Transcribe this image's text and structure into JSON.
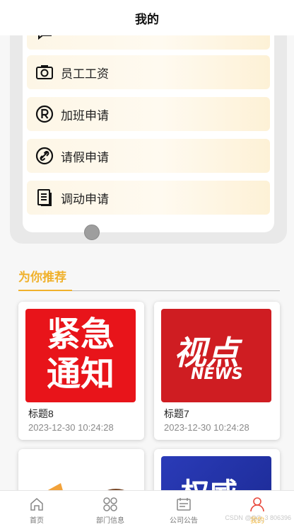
{
  "header": {
    "title": "我的"
  },
  "menu": {
    "items": [
      {
        "label": "",
        "icon": "chat-icon"
      },
      {
        "label": "员工工资",
        "icon": "camera-icon"
      },
      {
        "label": "加班申请",
        "icon": "registered-icon"
      },
      {
        "label": "请假申请",
        "icon": "link-icon"
      },
      {
        "label": "调动申请",
        "icon": "document-icon"
      }
    ]
  },
  "recommend": {
    "title": "为你推荐",
    "accent_color": "#f0b12c",
    "cards": [
      {
        "title": "标题8",
        "time": "2023-12-30 10:24:28",
        "image_text_line1": "紧急",
        "image_text_line2": "通知"
      },
      {
        "title": "标题7",
        "time": "2023-12-30 10:24:28",
        "image_text_line1": "视点",
        "image_text_line2": "NEWS"
      },
      {
        "title": "",
        "time": ""
      },
      {
        "title": "",
        "time": "",
        "image_text_line1": "权威"
      }
    ]
  },
  "tabbar": {
    "tabs": [
      {
        "label": "首页",
        "icon": "home-icon"
      },
      {
        "label": "部门信息",
        "icon": "grid-icon"
      },
      {
        "label": "公司公告",
        "icon": "calendar-icon"
      },
      {
        "label": "我的",
        "icon": "user-icon",
        "active": true
      }
    ]
  },
  "watermark": "CSDN @QQ_3 806396"
}
